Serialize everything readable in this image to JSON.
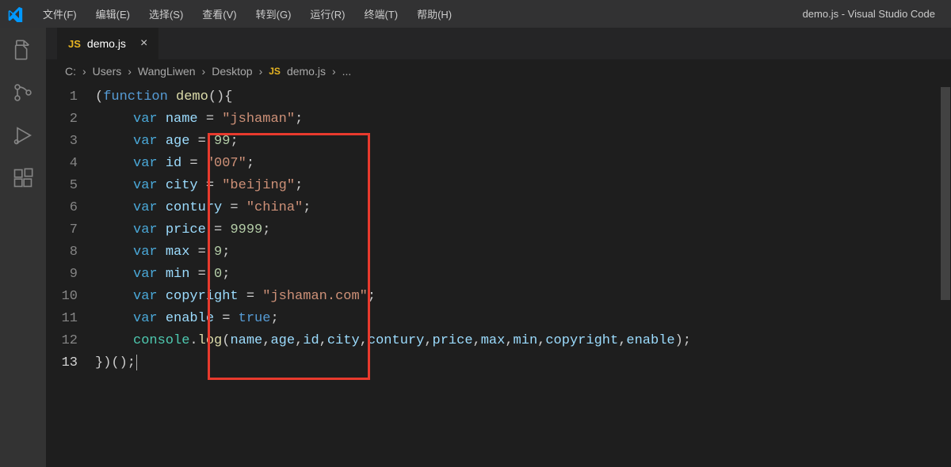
{
  "titlebar": {
    "app_title": "demo.js - Visual Studio Code",
    "menu": [
      "文件(F)",
      "编辑(E)",
      "选择(S)",
      "查看(V)",
      "转到(G)",
      "运行(R)",
      "终端(T)",
      "帮助(H)"
    ]
  },
  "tab": {
    "badge": "JS",
    "label": "demo.js",
    "close": "×"
  },
  "breadcrumb": {
    "parts": [
      "C:",
      "Users",
      "WangLiwen",
      "Desktop"
    ],
    "file_badge": "JS",
    "file": "demo.js",
    "trailing": "..."
  },
  "code": {
    "lines": [
      {
        "n": "1",
        "tokens": [
          {
            "t": "(",
            "c": "tk-punct"
          },
          {
            "t": "function",
            "c": "tk-kw"
          },
          {
            "t": " ",
            "c": ""
          },
          {
            "t": "demo",
            "c": "tk-fn"
          },
          {
            "t": "(){",
            "c": "tk-punct"
          }
        ]
      },
      {
        "n": "2",
        "indent": true,
        "tokens": [
          {
            "t": "var",
            "c": "tk-decl"
          },
          {
            "t": " ",
            "c": ""
          },
          {
            "t": "name",
            "c": "tk-var"
          },
          {
            "t": " = ",
            "c": "tk-punct"
          },
          {
            "t": "\"jshaman\"",
            "c": "tk-str"
          },
          {
            "t": ";",
            "c": "tk-punct"
          }
        ]
      },
      {
        "n": "3",
        "indent": true,
        "tokens": [
          {
            "t": "var",
            "c": "tk-decl"
          },
          {
            "t": " ",
            "c": ""
          },
          {
            "t": "age",
            "c": "tk-var"
          },
          {
            "t": " = ",
            "c": "tk-punct"
          },
          {
            "t": "99",
            "c": "tk-num"
          },
          {
            "t": ";",
            "c": "tk-punct"
          }
        ]
      },
      {
        "n": "4",
        "indent": true,
        "tokens": [
          {
            "t": "var",
            "c": "tk-decl"
          },
          {
            "t": " ",
            "c": ""
          },
          {
            "t": "id",
            "c": "tk-var"
          },
          {
            "t": " = ",
            "c": "tk-punct"
          },
          {
            "t": "\"007\"",
            "c": "tk-str"
          },
          {
            "t": ";",
            "c": "tk-punct"
          }
        ]
      },
      {
        "n": "5",
        "indent": true,
        "tokens": [
          {
            "t": "var",
            "c": "tk-decl"
          },
          {
            "t": " ",
            "c": ""
          },
          {
            "t": "city",
            "c": "tk-var"
          },
          {
            "t": " = ",
            "c": "tk-punct"
          },
          {
            "t": "\"beijing\"",
            "c": "tk-str"
          },
          {
            "t": ";",
            "c": "tk-punct"
          }
        ]
      },
      {
        "n": "6",
        "indent": true,
        "tokens": [
          {
            "t": "var",
            "c": "tk-decl"
          },
          {
            "t": " ",
            "c": ""
          },
          {
            "t": "contury",
            "c": "tk-var"
          },
          {
            "t": " = ",
            "c": "tk-punct"
          },
          {
            "t": "\"china\"",
            "c": "tk-str"
          },
          {
            "t": ";",
            "c": "tk-punct"
          }
        ]
      },
      {
        "n": "7",
        "indent": true,
        "tokens": [
          {
            "t": "var",
            "c": "tk-decl"
          },
          {
            "t": " ",
            "c": ""
          },
          {
            "t": "price",
            "c": "tk-var"
          },
          {
            "t": " = ",
            "c": "tk-punct"
          },
          {
            "t": "9999",
            "c": "tk-num"
          },
          {
            "t": ";",
            "c": "tk-punct"
          }
        ]
      },
      {
        "n": "8",
        "indent": true,
        "tokens": [
          {
            "t": "var",
            "c": "tk-decl"
          },
          {
            "t": " ",
            "c": ""
          },
          {
            "t": "max",
            "c": "tk-var"
          },
          {
            "t": " = ",
            "c": "tk-punct"
          },
          {
            "t": "9",
            "c": "tk-num"
          },
          {
            "t": ";",
            "c": "tk-punct"
          }
        ]
      },
      {
        "n": "9",
        "indent": true,
        "tokens": [
          {
            "t": "var",
            "c": "tk-decl"
          },
          {
            "t": " ",
            "c": ""
          },
          {
            "t": "min",
            "c": "tk-var"
          },
          {
            "t": " = ",
            "c": "tk-punct"
          },
          {
            "t": "0",
            "c": "tk-num"
          },
          {
            "t": ";",
            "c": "tk-punct"
          }
        ]
      },
      {
        "n": "10",
        "indent": true,
        "tokens": [
          {
            "t": "var",
            "c": "tk-decl"
          },
          {
            "t": " ",
            "c": ""
          },
          {
            "t": "copyright",
            "c": "tk-var"
          },
          {
            "t": " = ",
            "c": "tk-punct"
          },
          {
            "t": "\"jshaman.com\"",
            "c": "tk-str"
          },
          {
            "t": ";",
            "c": "tk-punct"
          }
        ]
      },
      {
        "n": "11",
        "indent": true,
        "tokens": [
          {
            "t": "var",
            "c": "tk-decl"
          },
          {
            "t": " ",
            "c": ""
          },
          {
            "t": "enable",
            "c": "tk-var"
          },
          {
            "t": " = ",
            "c": "tk-punct"
          },
          {
            "t": "true",
            "c": "tk-kw"
          },
          {
            "t": ";",
            "c": "tk-punct"
          }
        ]
      },
      {
        "n": "12",
        "indent": true,
        "tokens": [
          {
            "t": "console",
            "c": "tk-obj"
          },
          {
            "t": ".",
            "c": "tk-punct"
          },
          {
            "t": "log",
            "c": "tk-fn"
          },
          {
            "t": "(",
            "c": "tk-punct"
          },
          {
            "t": "name",
            "c": "tk-var"
          },
          {
            "t": ",",
            "c": "tk-punct"
          },
          {
            "t": "age",
            "c": "tk-var"
          },
          {
            "t": ",",
            "c": "tk-punct"
          },
          {
            "t": "id",
            "c": "tk-var"
          },
          {
            "t": ",",
            "c": "tk-punct"
          },
          {
            "t": "city",
            "c": "tk-var"
          },
          {
            "t": ",",
            "c": "tk-punct"
          },
          {
            "t": "contury",
            "c": "tk-var"
          },
          {
            "t": ",",
            "c": "tk-punct"
          },
          {
            "t": "price",
            "c": "tk-var"
          },
          {
            "t": ",",
            "c": "tk-punct"
          },
          {
            "t": "max",
            "c": "tk-var"
          },
          {
            "t": ",",
            "c": "tk-punct"
          },
          {
            "t": "min",
            "c": "tk-var"
          },
          {
            "t": ",",
            "c": "tk-punct"
          },
          {
            "t": "copyright",
            "c": "tk-var"
          },
          {
            "t": ",",
            "c": "tk-punct"
          },
          {
            "t": "enable",
            "c": "tk-var"
          },
          {
            "t": ");",
            "c": "tk-punct"
          }
        ]
      },
      {
        "n": "13",
        "tokens": [
          {
            "t": "})();",
            "c": "tk-punct"
          }
        ],
        "cursor": true
      }
    ]
  }
}
